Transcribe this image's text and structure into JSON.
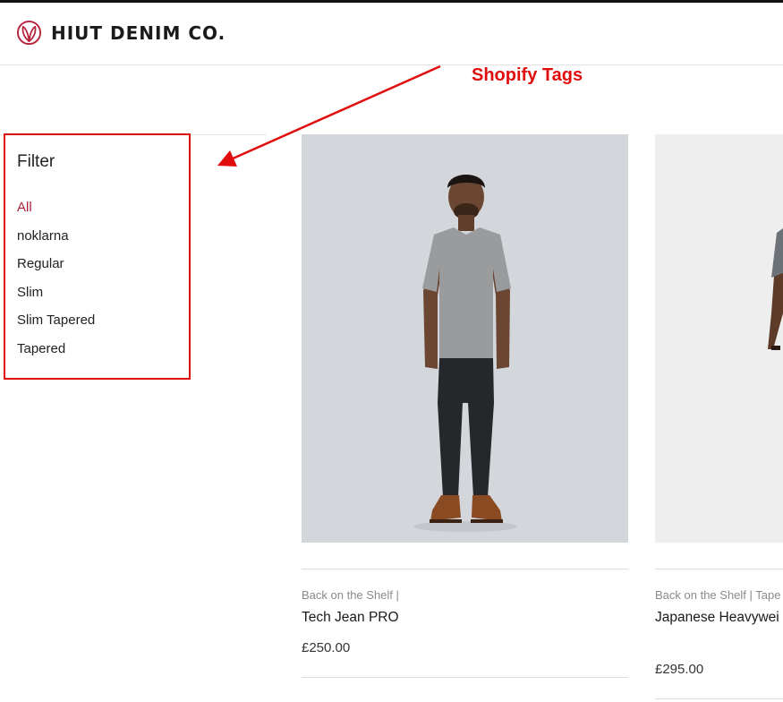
{
  "header": {
    "brand_name": "HIUT DENIM CO.",
    "brand_icon": "leaf-logo-icon",
    "brand_color": "#b8233c"
  },
  "annotation": {
    "label": "Shopify Tags",
    "color": "#e10d0d"
  },
  "filter": {
    "title": "Filter",
    "active_color": "#a8223a",
    "items": [
      {
        "label": "All",
        "active": true
      },
      {
        "label": "noklarna",
        "active": false
      },
      {
        "label": "Regular",
        "active": false
      },
      {
        "label": "Slim",
        "active": false
      },
      {
        "label": "Slim Tapered",
        "active": false
      },
      {
        "label": "Tapered",
        "active": false
      }
    ]
  },
  "products": [
    {
      "vendor": "Back on the Shelf |",
      "name": "Tech Jean PRO",
      "price": "£250.00"
    },
    {
      "vendor": "Back on the Shelf | Tape",
      "name": "Japanese Heavywei Tapered Fit",
      "price": "£295.00"
    }
  ]
}
